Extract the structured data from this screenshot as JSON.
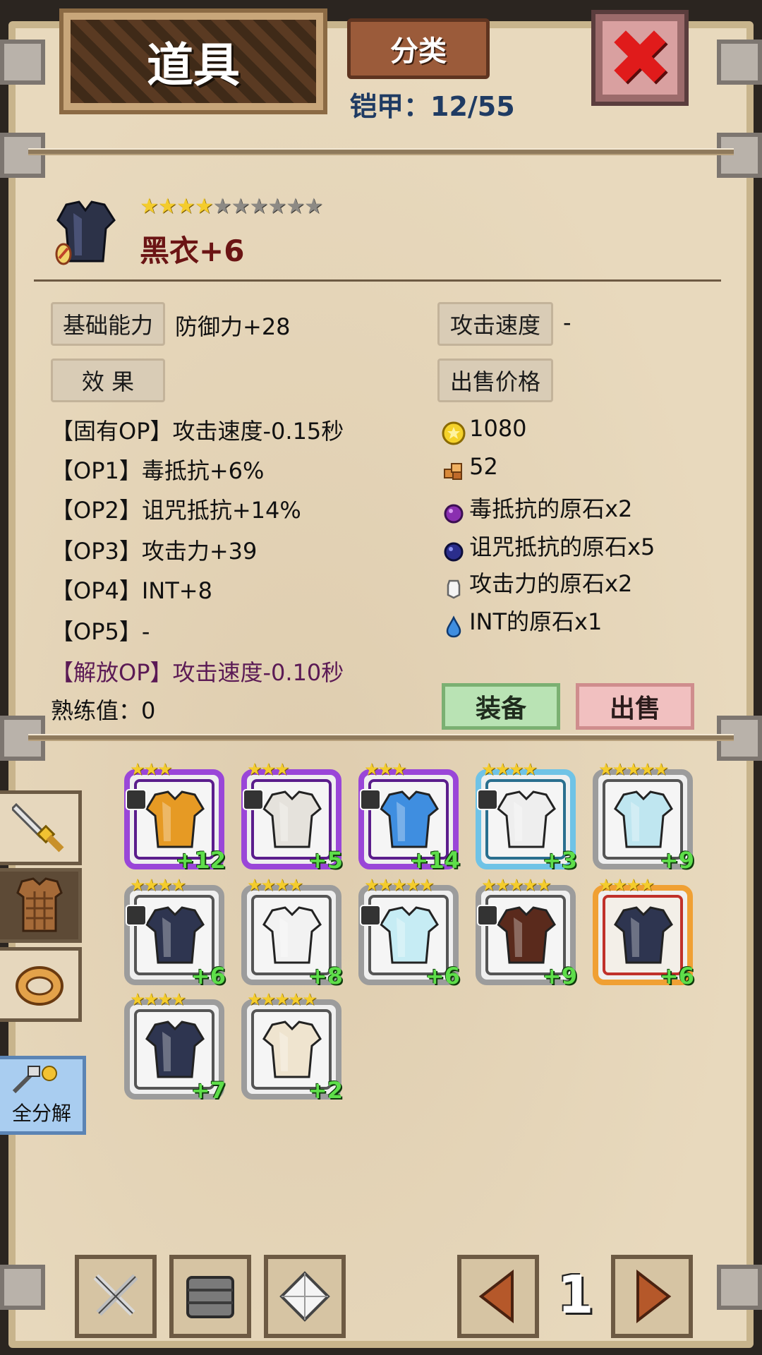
{
  "header": {
    "title": "道具",
    "category_button": "分类",
    "armor_count": "铠甲：12/55"
  },
  "item": {
    "name": "黑衣+6",
    "stars_filled": 4,
    "stars_total": 10,
    "basic_ability_label": "基础能力",
    "basic_ability_value": "防御力+28",
    "attack_speed_label": "攻击速度",
    "attack_speed_value": "-",
    "effect_label": "效 果",
    "sell_price_label": "出售价格",
    "options": [
      "【固有OP】攻击速度-0.15秒",
      "【OP1】毒抵抗+6%",
      "【OP2】诅咒抵抗+14%",
      "【OP3】攻击力+39",
      "【OP4】INT+8",
      "【OP5】-",
      "【解放OP】攻击速度-0.10秒"
    ],
    "proficiency": "熟练值：0",
    "sell_rewards": [
      {
        "icon": "gold-coin-icon",
        "text": "1080"
      },
      {
        "icon": "material-icon",
        "text": "52"
      },
      {
        "icon": "purple-gem-icon",
        "text": "毒抵抗的原石x2"
      },
      {
        "icon": "dark-blue-gem-icon",
        "text": "诅咒抵抗的原石x5"
      },
      {
        "icon": "white-crystal-icon",
        "text": "攻击力的原石x2"
      },
      {
        "icon": "blue-drop-icon",
        "text": "INT的原石x1"
      }
    ]
  },
  "actions": {
    "equip": "装备",
    "sell": "出售"
  },
  "inventory": [
    {
      "stars": "★★★",
      "plus": "+12",
      "rarity": "purple",
      "color": "#e69a24",
      "locked": true
    },
    {
      "stars": "★★★",
      "plus": "+5",
      "rarity": "purple",
      "color": "#e5e2dc",
      "locked": true
    },
    {
      "stars": "★★★",
      "plus": "+14",
      "rarity": "purple",
      "color": "#3f8ee0",
      "locked": true
    },
    {
      "stars": "★★★★",
      "plus": "+3",
      "rarity": "blue",
      "color": "#eeeeee",
      "locked": true
    },
    {
      "stars": "★★★★★",
      "plus": "+9",
      "rarity": "gray",
      "color": "#bfe6f0",
      "locked": false
    },
    {
      "stars": "★★★★",
      "plus": "+6",
      "rarity": "gray",
      "color": "#2e3550",
      "locked": true
    },
    {
      "stars": "★★★★",
      "plus": "+8",
      "rarity": "gray",
      "color": "#f2f2f2",
      "locked": false
    },
    {
      "stars": "★★★★★",
      "plus": "+6",
      "rarity": "gray",
      "color": "#c6ecf4",
      "locked": true
    },
    {
      "stars": "★★★★★",
      "plus": "+9",
      "rarity": "gray",
      "color": "#5a2a1c",
      "locked": true
    },
    {
      "stars": "★★★★",
      "plus": "+6",
      "rarity": "gold",
      "color": "#2e3550",
      "locked": false
    },
    {
      "stars": "★★★★",
      "plus": "+7",
      "rarity": "gray",
      "color": "#2e3550",
      "locked": false
    },
    {
      "stars": "★★★★★",
      "plus": "+2",
      "rarity": "gray",
      "color": "#efe4cf",
      "locked": false
    }
  ],
  "side_tabs": [
    {
      "icon": "sword-icon"
    },
    {
      "icon": "armor-icon"
    },
    {
      "icon": "ring-icon"
    }
  ],
  "disassemble_label": "全分解",
  "bottom_bar": {
    "page": "1",
    "left_buttons": [
      "crossed-swords-icon",
      "chest-icon",
      "diamond-icon"
    ]
  }
}
